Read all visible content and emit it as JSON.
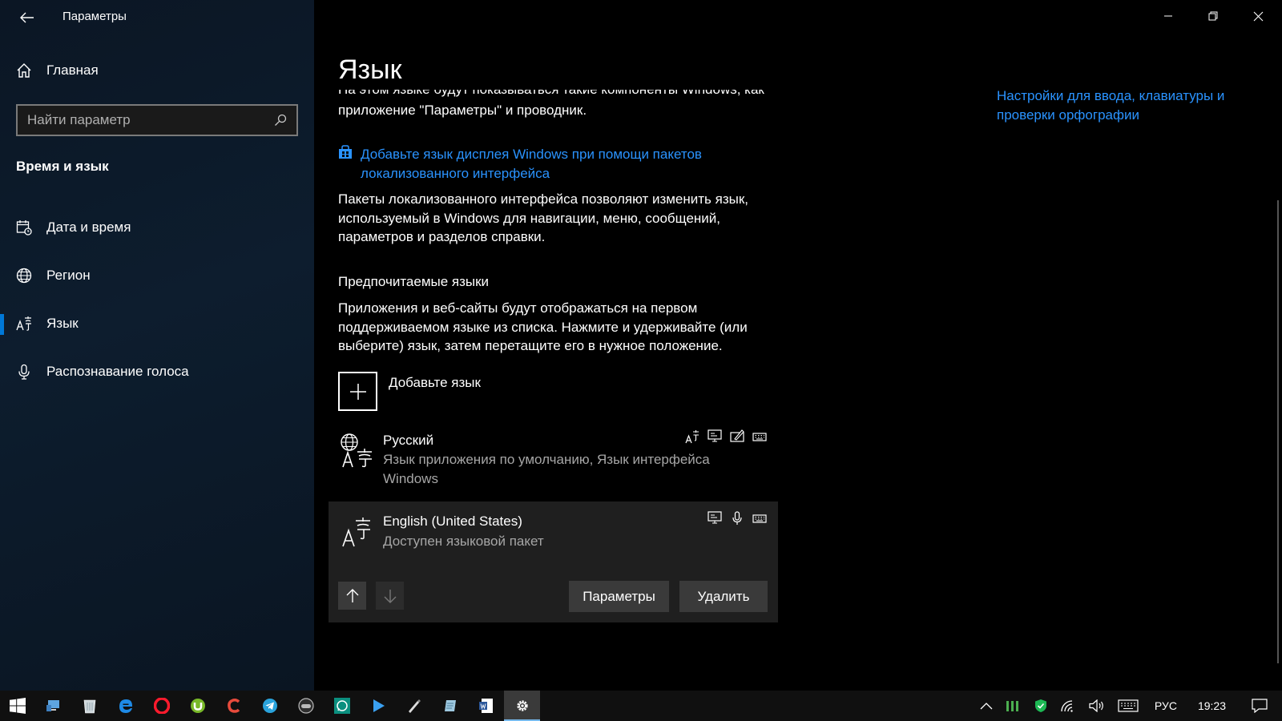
{
  "window": {
    "app_title": "Параметры"
  },
  "sidebar": {
    "home_label": "Главная",
    "search_placeholder": "Найти параметр",
    "section_title": "Время и язык",
    "items": [
      {
        "label": "Дата и время",
        "icon": "calendar-clock-icon"
      },
      {
        "label": "Регион",
        "icon": "globe-icon"
      },
      {
        "label": "Язык",
        "icon": "language-icon",
        "active": true
      },
      {
        "label": "Распознавание голоса",
        "icon": "microphone-icon"
      }
    ]
  },
  "main": {
    "title": "Язык",
    "cut_text_line1": "На этом языке будут показываться такие компоненты Windows, как",
    "cut_text_line2": "приложение \"Параметры\" и проводник.",
    "right_link": "Настройки для ввода, клавиатуры и проверки орфографии",
    "pack_link": "Добавьте язык дисплея Windows при помощи пакетов локализованного интерфейса",
    "pack_desc": "Пакеты локализованного интерфейса позволяют изменить язык, используемый в Windows для навигации, меню, сообщений, параметров и разделов справки.",
    "preferred_title": "Предпочитаемые языки",
    "preferred_desc": "Приложения и веб-сайты будут отображаться на первом поддерживаемом языке из списка. Нажмите и удерживайте (или выберите) язык, затем перетащите его в нужное положение.",
    "add_language": "Добавьте язык",
    "languages": [
      {
        "name": "Русский",
        "sub": "Язык приложения по умолчанию, Язык интерфейса Windows"
      },
      {
        "name": "English (United States)",
        "sub": "Доступен языковой пакет"
      }
    ],
    "options_button": "Параметры",
    "remove_button": "Удалить"
  },
  "taskbar": {
    "language_indicator": "РУС",
    "time": "19:23"
  },
  "colors": {
    "accent": "#0078d7",
    "link": "#2a93ff"
  }
}
